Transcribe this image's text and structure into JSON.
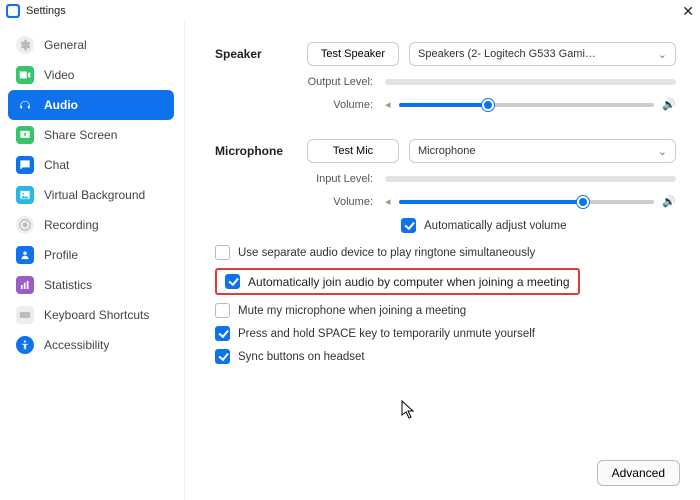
{
  "window": {
    "title": "Settings"
  },
  "sidebar": {
    "items": [
      {
        "label": "General"
      },
      {
        "label": "Video"
      },
      {
        "label": "Audio"
      },
      {
        "label": "Share Screen"
      },
      {
        "label": "Chat"
      },
      {
        "label": "Virtual Background"
      },
      {
        "label": "Recording"
      },
      {
        "label": "Profile"
      },
      {
        "label": "Statistics"
      },
      {
        "label": "Keyboard Shortcuts"
      },
      {
        "label": "Accessibility"
      }
    ]
  },
  "speaker": {
    "heading": "Speaker",
    "test_label": "Test Speaker",
    "device": "Speakers (2- Logitech G533 Gami…",
    "output_label": "Output Level:",
    "volume_label": "Volume:",
    "volume_pct": 35
  },
  "mic": {
    "heading": "Microphone",
    "test_label": "Test Mic",
    "device": "Microphone",
    "input_label": "Input Level:",
    "volume_label": "Volume:",
    "volume_pct": 72,
    "auto_adjust": "Automatically adjust volume"
  },
  "options": {
    "separate_ringtone": "Use separate audio device to play ringtone simultaneously",
    "auto_join": "Automatically join audio by computer when joining a meeting",
    "mute_on_join": "Mute my microphone when joining a meeting",
    "space_unmute": "Press and hold SPACE key to temporarily unmute yourself",
    "sync_headset": "Sync buttons on headset"
  },
  "footer": {
    "advanced": "Advanced"
  }
}
